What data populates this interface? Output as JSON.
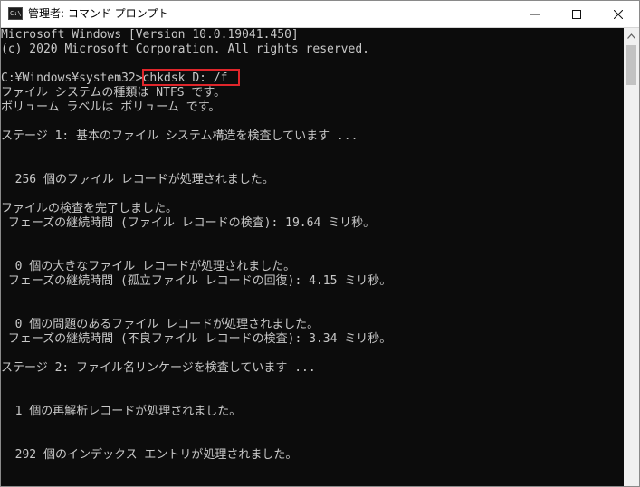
{
  "window": {
    "title": "管理者: コマンド プロンプト",
    "icon_text": "C:\\",
    "icons": {
      "app": "console-app-icon",
      "minimize": "minimize-icon",
      "maximize": "maximize-icon",
      "close": "close-icon",
      "scroll_up": "scroll-up-arrow-icon"
    }
  },
  "console": {
    "prompt": "C:¥Windows¥system32>",
    "command": "chkdsk D: /f",
    "lines": [
      "Microsoft Windows [Version 10.0.19041.450]",
      "(c) 2020 Microsoft Corporation. All rights reserved.",
      "ファイル システムの種類は NTFS です。",
      "ボリューム ラベルは ボリューム です。",
      "ステージ 1: 基本のファイル システム構造を検査しています ...",
      "  256 個のファイル レコードが処理されました。",
      "ファイルの検査を完了しました。",
      " フェーズの継続時間 (ファイル レコードの検査): 19.64 ミリ秒。",
      "  0 個の大きなファイル レコードが処理されました。",
      " フェーズの継続時間 (孤立ファイル レコードの回復): 4.15 ミリ秒。",
      "  0 個の問題のあるファイル レコードが処理されました。",
      " フェーズの継続時間 (不良ファイル レコードの検査): 3.34 ミリ秒。",
      "ステージ 2: ファイル名リンケージを検査しています ...",
      "  1 個の再解析レコードが処理されました。",
      "  292 個のインデックス エントリが処理されました。"
    ]
  },
  "colors": {
    "console_background": "#0c0c0c",
    "console_text": "#c8c8c8",
    "highlight_box": "#e0262b",
    "titlebar_background": "#ffffff",
    "scrollbar_track": "#f0f0f0",
    "scrollbar_thumb": "#c2c2c2"
  }
}
